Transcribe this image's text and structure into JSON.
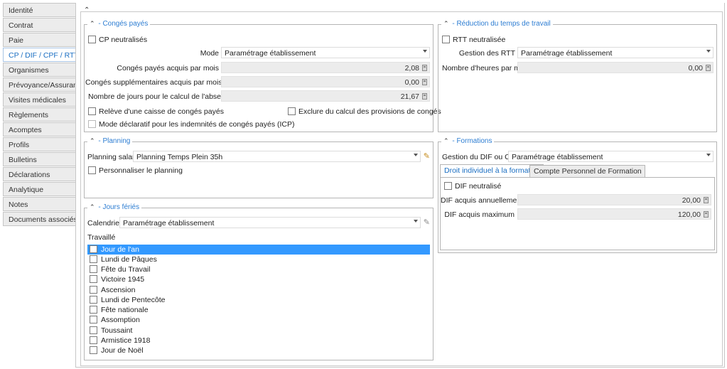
{
  "nav": {
    "items": [
      "Identité",
      "Contrat",
      "Paie",
      "CP / DIF / CPF / RTT",
      "Organismes",
      "Prévoyance/Assurance",
      "Visites médicales",
      "Règlements",
      "Acomptes",
      "Profils",
      "Bulletins",
      "Déclarations",
      "Analytique",
      "Notes",
      "Documents associés"
    ],
    "active_index": 3
  },
  "conges": {
    "title": "Congés payés",
    "cp_neutralises": "CP neutralisés",
    "mode_label": "Mode",
    "mode_value": "Paramétrage établissement",
    "acquis_label": "Congés payés acquis par mois",
    "acquis_value": "2,08",
    "supp_label": "Congés supplémentaires acquis par mois",
    "supp_value": "0,00",
    "jours_label": "Nombre de jours pour le calcul de l'absence CP",
    "jours_value": "21,67",
    "releve": "Relève d'une caisse de congés payés",
    "exclure": "Exclure du calcul des provisions de congés",
    "mode_declaratif": "Mode déclaratif pour les indemnités de congés payés (ICP)"
  },
  "rtt": {
    "title": "Réduction du temps de travail",
    "neutralisee": "RTT neutralisée",
    "gestion_label": "Gestion des RTT",
    "gestion_value": "Paramétrage établissement",
    "heures_label": "Nombre d'heures par mois",
    "heures_value": "0,00"
  },
  "planning": {
    "title": "Planning",
    "salarie_label": "Planning salarié",
    "salarie_value": "Planning Temps Plein 35h",
    "personnaliser": "Personnaliser le planning"
  },
  "formations": {
    "title": "Formations",
    "gestion_label": "Gestion du DIF ou CPF",
    "gestion_value": "Paramétrage établissement",
    "tab1": "Droit individuel à la formation",
    "tab2": "Compte Personnel de Formation",
    "dif_neutralise": "DIF neutralisé",
    "annuel_label": "DIF acquis annuellement",
    "annuel_value": "20,00",
    "max_label": "DIF acquis maximum",
    "max_value": "120,00"
  },
  "feries": {
    "title": "Jours fériés",
    "calendrier_label": "Calendrier",
    "calendrier_value": "Paramétrage établissement",
    "travaille_label": "Travaillé",
    "items": [
      "Jour de l'an",
      "Lundi de Pâques",
      "Fête du Travail",
      "Victoire 1945",
      "Ascension",
      "Lundi de Pentecôte",
      "Fête nationale",
      "Assomption",
      "Toussaint",
      "Armistice 1918",
      "Jour de Noël"
    ],
    "selected_index": 0
  }
}
